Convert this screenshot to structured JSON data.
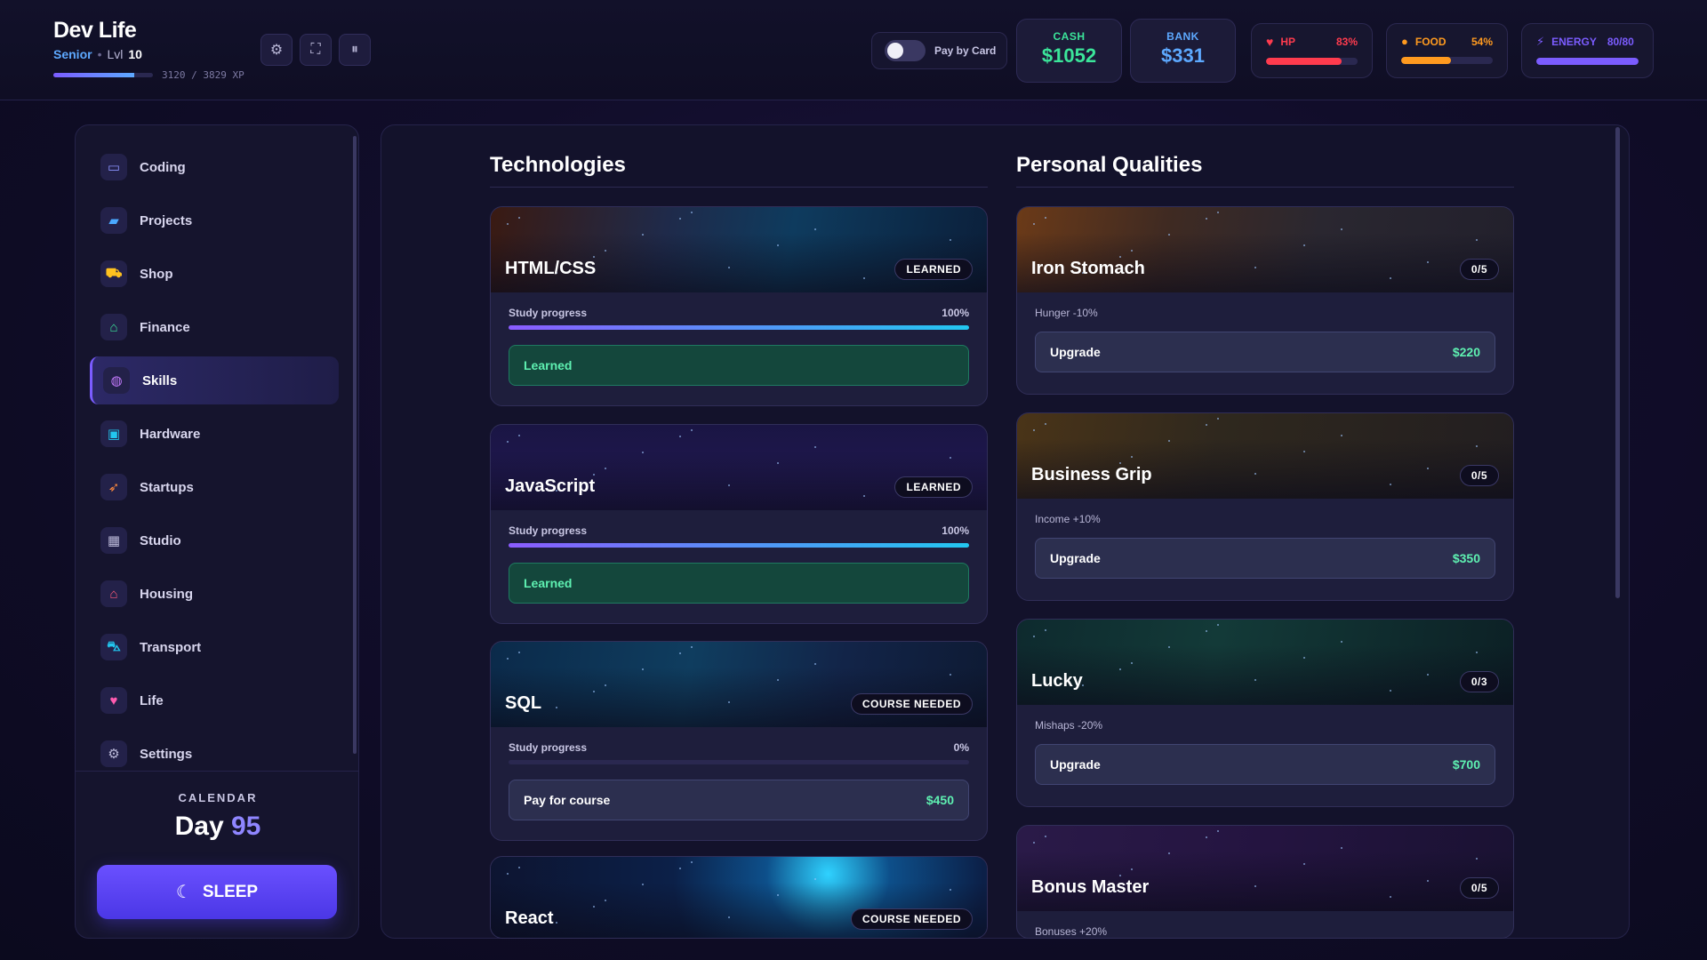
{
  "header": {
    "title": "Dev Life",
    "rank": "Senior",
    "separator": "•",
    "level_label": "Lvl",
    "level": "10",
    "xp_text": "3120 / 3829 XP",
    "xp_fraction": 0.81,
    "controls": [
      {
        "name": "settings",
        "glyph": "⚙"
      },
      {
        "name": "fullscreen",
        "glyph": "⛶"
      },
      {
        "name": "pause",
        "glyph": "⏸"
      }
    ],
    "pay_by_card_label": "Pay by Card",
    "pay_by_card_on": false,
    "cash": {
      "label": "CASH",
      "value": "$1052",
      "color": "#3be59a"
    },
    "bank": {
      "label": "BANK",
      "value": "$331",
      "color": "#5da9ff"
    },
    "hp": {
      "label": "HP",
      "value": "83%",
      "level": 0.83,
      "color": "#ff3b4e",
      "icon": "heart-icon"
    },
    "food": {
      "label": "FOOD",
      "value": "54%",
      "level": 0.54,
      "color": "#ff9a1f",
      "icon": "burger-icon"
    },
    "energy": {
      "label": "ENERGY",
      "value": "80/80",
      "level": 1.0,
      "color": "#7b5cff",
      "icon": "bolt-icon"
    }
  },
  "sidebar": {
    "items": [
      {
        "label": "Coding",
        "icon": "laptop-icon",
        "glyph": "▭",
        "color": "#8b93ff",
        "active": false
      },
      {
        "label": "Projects",
        "icon": "folder-icon",
        "glyph": "▰",
        "color": "#4aa8ff",
        "active": false
      },
      {
        "label": "Shop",
        "icon": "cart-icon",
        "glyph": "⛟",
        "color": "#ffc21f",
        "active": false
      },
      {
        "label": "Finance",
        "icon": "bank-icon",
        "glyph": "⌂",
        "color": "#3be59a",
        "active": false
      },
      {
        "label": "Skills",
        "icon": "brain-icon",
        "glyph": "◍",
        "color": "#c57bff",
        "active": true
      },
      {
        "label": "Hardware",
        "icon": "chip-icon",
        "glyph": "▣",
        "color": "#22c7f0",
        "active": false
      },
      {
        "label": "Startups",
        "icon": "rocket-icon",
        "glyph": "➶",
        "color": "#ff8a3d",
        "active": false
      },
      {
        "label": "Studio",
        "icon": "building-icon",
        "glyph": "▦",
        "color": "#b8b6d6",
        "active": false
      },
      {
        "label": "Housing",
        "icon": "house-icon",
        "glyph": "⌂",
        "color": "#ff5b7a",
        "active": false
      },
      {
        "label": "Transport",
        "icon": "car-icon",
        "glyph": "⛍",
        "color": "#22c7f0",
        "active": false
      },
      {
        "label": "Life",
        "icon": "heart-icon",
        "glyph": "♥",
        "color": "#ff5bb0",
        "active": false
      },
      {
        "label": "Settings",
        "icon": "gear-icon",
        "glyph": "⚙",
        "color": "#b8b6d6",
        "active": false
      }
    ],
    "calendar_label": "CALENDAR",
    "day_label": "Day",
    "day_number": "95",
    "sleep_label": "SLEEP"
  },
  "technologies": {
    "heading": "Technologies",
    "progress_label": "Study progress",
    "cards": [
      {
        "name": "HTML/CSS",
        "badge": "LEARNED",
        "progress_text": "100%",
        "progress": 1.0,
        "action": "Learned",
        "price": "",
        "state": "learned",
        "banner": "html"
      },
      {
        "name": "JavaScript",
        "badge": "LEARNED",
        "progress_text": "100%",
        "progress": 1.0,
        "action": "Learned",
        "price": "",
        "state": "learned",
        "banner": "js"
      },
      {
        "name": "SQL",
        "badge": "COURSE NEEDED",
        "progress_text": "0%",
        "progress": 0.0,
        "action": "Pay for course",
        "price": "$450",
        "state": "pay",
        "banner": "sql"
      },
      {
        "name": "React",
        "badge": "COURSE NEEDED",
        "progress_text": "",
        "progress": 0.0,
        "action": "",
        "price": "",
        "state": "partial",
        "banner": "react"
      }
    ]
  },
  "qualities": {
    "heading": "Personal Qualities",
    "upgrade_label": "Upgrade",
    "cards": [
      {
        "name": "Iron Stomach",
        "badge": "0/5",
        "effect": "Hunger -10%",
        "price": "$220",
        "banner": "food"
      },
      {
        "name": "Business Grip",
        "badge": "0/5",
        "effect": "Income +10%",
        "price": "$350",
        "banner": "biz"
      },
      {
        "name": "Lucky",
        "badge": "0/3",
        "effect": "Mishaps -20%",
        "price": "$700",
        "banner": "dice"
      },
      {
        "name": "Bonus Master",
        "badge": "0/5",
        "effect": "Bonuses +20%",
        "price": "",
        "banner": "gem"
      }
    ]
  }
}
